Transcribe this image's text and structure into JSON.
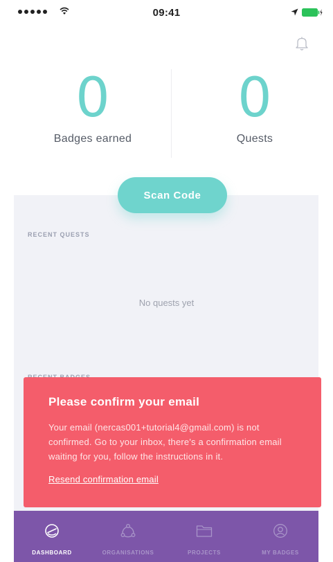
{
  "status_bar": {
    "time": "09:41",
    "signal_icon": "signal-dots-icon",
    "wifi_icon": "wifi-icon",
    "location_icon": "location-arrow-icon",
    "battery_icon": "battery-charging-icon"
  },
  "header": {
    "notification_icon": "bell-icon"
  },
  "stats": {
    "badges": {
      "value": "0",
      "label": "Badges earned"
    },
    "quests": {
      "value": "0",
      "label": "Quests"
    }
  },
  "actions": {
    "scan_label": "Scan Code"
  },
  "recent_quests": {
    "title": "RECENT QUESTS",
    "empty_text": "No quests yet"
  },
  "recent_badges": {
    "title": "RECENT BADGES"
  },
  "alert": {
    "title": "Please confirm your email",
    "body": "Your email (nercas001+tutorial4@gmail.com) is not confirmed. Go to your inbox, there's a confirmation email waiting for you, follow the instructions in it.",
    "link": "Resend confirmation email"
  },
  "tabs": [
    {
      "label": "DASHBOARD",
      "icon": "gauge-icon",
      "active": true
    },
    {
      "label": "ORGANISATIONS",
      "icon": "organisations-icon",
      "active": false
    },
    {
      "label": "PROJECTS",
      "icon": "folder-icon",
      "active": false
    },
    {
      "label": "MY BADGES",
      "icon": "user-circle-icon",
      "active": false
    }
  ],
  "colors": {
    "accent": "#6fd4cd",
    "alert": "#f45d6b",
    "tab_bar": "#7d56a9",
    "content_bg": "#f1f2f7"
  }
}
